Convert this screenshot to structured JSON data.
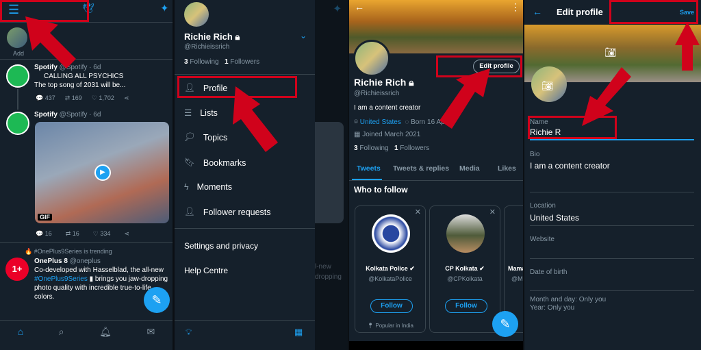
{
  "colors": {
    "background": "#15202b",
    "accent": "#1da1f2",
    "highlight": "#d0021b",
    "spotify": "#1db954",
    "oneplus": "#eb0028"
  },
  "panel1": {
    "fleet_add": "Add",
    "tweets": [
      {
        "name": "Spotify",
        "handle": "@Spotify · 6d",
        "line1": "CALLING ALL PSYCHICS",
        "line2": "The top song of 2031 will be...",
        "replies": "437",
        "retweets": "169",
        "likes": "1,702"
      },
      {
        "name": "Spotify",
        "handle": "@Spotify · 6d",
        "media_badge": "GIF",
        "replies": "16",
        "retweets": "16",
        "likes": "334"
      }
    ],
    "trending": "#OnePlus9Series is trending",
    "promo": {
      "name": "OnePlus 8",
      "handle": "@oneplus",
      "text1": "Co-developed with Hasselblad, the all-new",
      "hashtag": "#OnePlus9Series",
      "text2": "brings you jaw-dropping",
      "text3": "photo quality with incredible true-to-life",
      "text4": "colors."
    },
    "icons": [
      "menu-icon",
      "twitter-logo",
      "sparkle-icon",
      "home-icon",
      "search-icon",
      "bell-icon",
      "mail-icon"
    ]
  },
  "panel2": {
    "name": "Richie Rich",
    "handle": "@Richieissrich",
    "following_count": "3",
    "following_label": "Following",
    "followers_count": "1",
    "followers_label": "Followers",
    "menu": [
      {
        "label": "Profile",
        "icon": "user-icon"
      },
      {
        "label": "Lists",
        "icon": "list-icon"
      },
      {
        "label": "Topics",
        "icon": "topic-icon"
      },
      {
        "label": "Bookmarks",
        "icon": "bookmark-icon"
      },
      {
        "label": "Moments",
        "icon": "bolt-icon"
      },
      {
        "label": "Follower requests",
        "icon": "user-plus-icon"
      }
    ],
    "settings": "Settings and privacy",
    "help": "Help Centre",
    "bg_text": [
      "l-new",
      "dropping"
    ]
  },
  "panel3": {
    "edit_button": "Edit profile",
    "name": "Richie Rich",
    "handle": "@Richieissrich",
    "bio": "I am a content creator",
    "location": "United States",
    "born": "Born 16 Ap",
    "born_tail": "2",
    "joined": "Joined March 2021",
    "following_count": "3",
    "following_label": "Following",
    "followers_count": "1",
    "followers_label": "Followers",
    "tabs": [
      "Tweets",
      "Tweets & replies",
      "Media",
      "Likes"
    ],
    "who_to_follow": "Who to follow",
    "cards": [
      {
        "name": "Kolkata Police",
        "handle": "@KolkataPolice",
        "button": "Follow",
        "note": "Popular in India"
      },
      {
        "name": "CP Kolkata",
        "handle": "@CPKolkata",
        "button": "Follow"
      },
      {
        "name": "Mama",
        "handle": "@M"
      }
    ]
  },
  "panel4": {
    "title": "Edit profile",
    "save": "Save",
    "fields": [
      {
        "label": "Name",
        "value": "Richie R"
      },
      {
        "label": "Bio",
        "value": "I am a content creator"
      },
      {
        "label": "Location",
        "value": "United States"
      },
      {
        "label": "Website",
        "value": ""
      },
      {
        "label": "Date of birth",
        "value": ""
      }
    ],
    "dob_note1": "Month and day: Only you",
    "dob_note2": "Year: Only you"
  }
}
